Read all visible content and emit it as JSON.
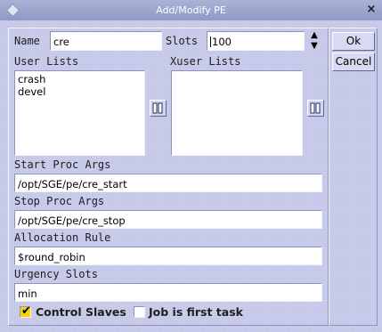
{
  "window": {
    "title": "Add/Modify PE",
    "close_glyph": "×"
  },
  "form": {
    "name_label": "Name",
    "name_value": "cre",
    "slots_label": "Slots",
    "slots_value": "100",
    "user_lists_label": "User Lists",
    "user_lists": [
      "crash",
      "devel"
    ],
    "xuser_lists_label": "Xuser Lists",
    "xuser_lists": [],
    "start_proc_args_label": "Start Proc Args",
    "start_proc_args_value": "/opt/SGE/pe/cre_start",
    "stop_proc_args_label": "Stop Proc Args",
    "stop_proc_args_value": "/opt/SGE/pe/cre_stop",
    "allocation_rule_label": "Allocation Rule",
    "allocation_rule_value": "$round_robin",
    "urgency_slots_label": "Urgency Slots",
    "urgency_slots_value": "min",
    "control_slaves_label": "Control Slaves",
    "control_slaves_checked": true,
    "job_first_task_label": "Job is first task",
    "job_first_task_checked": false
  },
  "buttons": {
    "ok_label": "Ok",
    "cancel_label": "Cancel"
  },
  "icons": {
    "window_menu": "diamond-icon",
    "close": "close-icon",
    "spinner_up": "arrow-up-icon",
    "spinner_down": "arrow-down-icon",
    "list_picker": "list-picker-icon"
  },
  "colors": {
    "titlebar": "#9aa5cf",
    "panel": "#c8cbe9",
    "checkbox_checked": "#f5d400"
  }
}
